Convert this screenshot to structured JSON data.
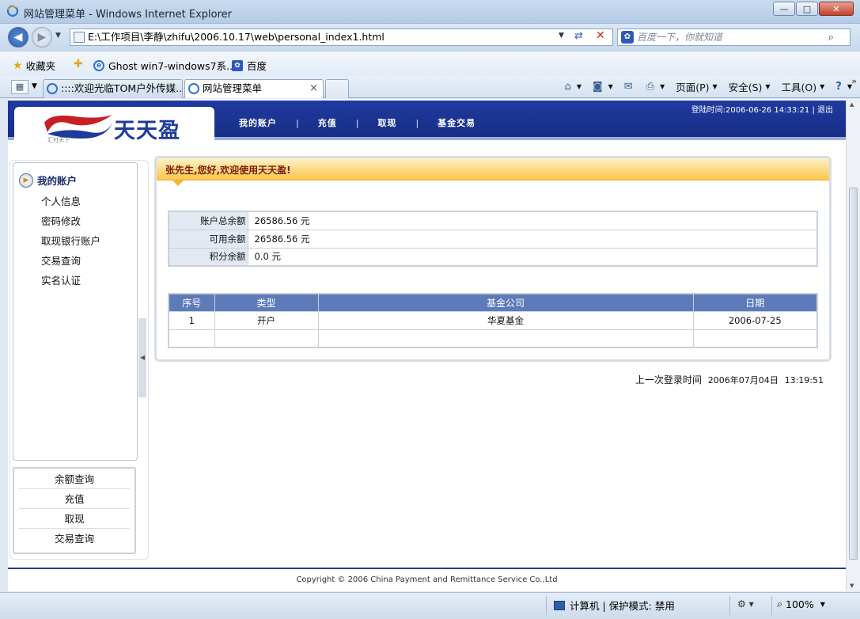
{
  "window": {
    "title": "网站管理菜单 - Windows Internet Explorer",
    "minimize": "—",
    "maximize": "□",
    "close": "✕"
  },
  "address": {
    "url": "E:\\工作项目\\李静\\zhifu\\2006.10.17\\web\\personal_index1.html",
    "search_placeholder": "百度一下，你就知道"
  },
  "favorites": {
    "label": "收藏夹",
    "items": [
      "Ghost win7-windows7系...",
      "百度"
    ]
  },
  "tabs": {
    "items": [
      {
        "label": "::::欢迎光临TOM户外传媒..."
      },
      {
        "label": "网站管理菜单"
      }
    ],
    "close": "×"
  },
  "commands": {
    "page": "页面(P)",
    "safety": "安全(S)",
    "tools": "工具(O)"
  },
  "site": {
    "logo_text": "天天盈",
    "logo_small": "汇付天下",
    "nav": [
      "我的账户",
      "充值",
      "取现",
      "基金交易"
    ],
    "login_label": "登陆时间:",
    "login_time": "2006-06-26 14:33:21",
    "logout": "退出"
  },
  "sidebar": {
    "title": "我的账户",
    "links": [
      "个人信息",
      "密码修改",
      "取现银行账户",
      "交易查询",
      "实名认证"
    ],
    "buttons": [
      "余额查询",
      "充值",
      "取现",
      "交易查询"
    ]
  },
  "panel": {
    "greeting": "张先生,您好,欢迎使用天天盈!",
    "balances": [
      {
        "label": "账户总余额",
        "value": "26586.56 元"
      },
      {
        "label": "可用余额",
        "value": "26586.56 元"
      },
      {
        "label": "积分余额",
        "value": "0.0 元"
      }
    ],
    "fund_table": {
      "headers": [
        "序号",
        "类型",
        "基金公司",
        "日期"
      ],
      "rows": [
        {
          "no": "1",
          "type": "开户",
          "company": "华夏基金",
          "date": "2006-07-25"
        }
      ]
    }
  },
  "last_login": {
    "label": "上一次登录时间",
    "date": "2006年07月04日",
    "time": "13:19:51"
  },
  "footer": {
    "copyright": "Copyright © 2006 China Payment and Remittance Service Co.,Ltd"
  },
  "status": {
    "zone": "计算机 | 保护模式: 禁用",
    "zoom": "100%"
  }
}
